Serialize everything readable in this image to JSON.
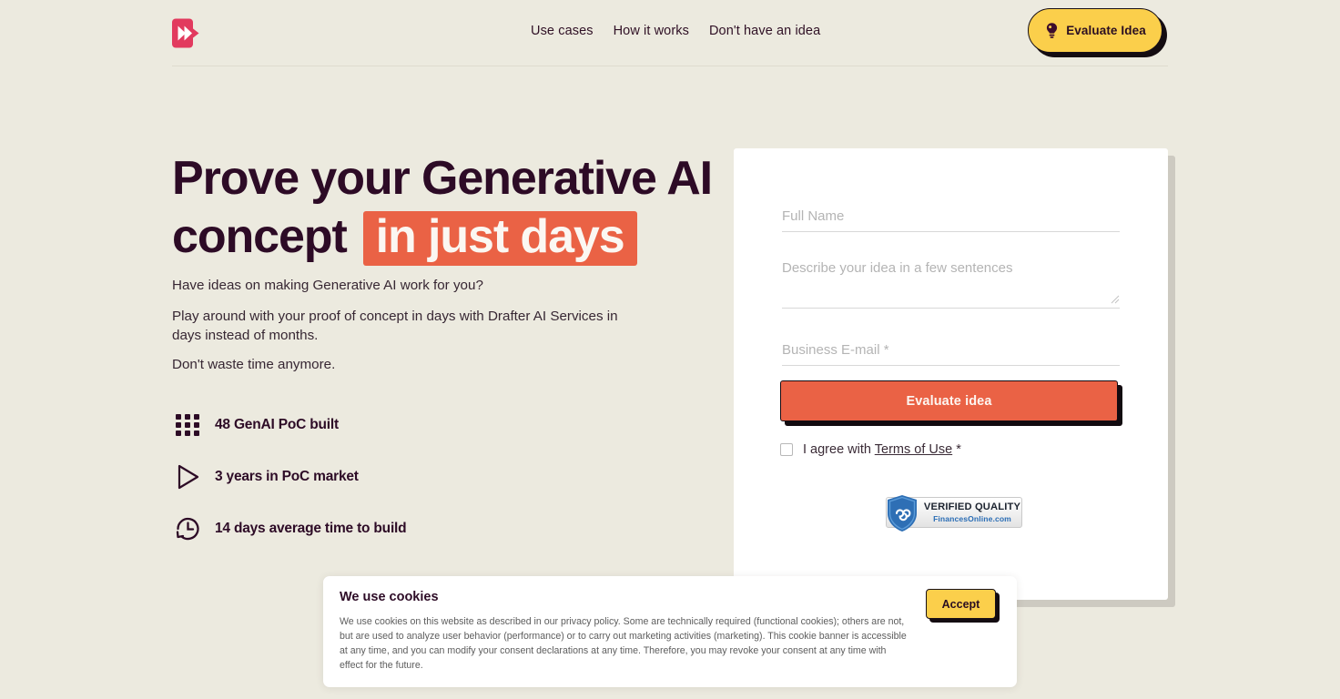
{
  "theme": {
    "page_bg": "#eceadf",
    "accent_orange": "#ea6245",
    "accent_yellow": "#fbcf4b",
    "ink": "#2d0b26"
  },
  "header": {
    "logo_name": "drafter-ai-logo",
    "nav": [
      {
        "label": "Use cases"
      },
      {
        "label": "How it works"
      },
      {
        "label": "Don't have an idea"
      }
    ],
    "cta": {
      "label": "Evaluate Idea",
      "icon": "lightbulb-icon"
    }
  },
  "hero": {
    "headline_line1": "Prove your Generative AI",
    "headline_line2_plain": "concept",
    "headline_line2_mark": "in just days",
    "paragraphs": [
      "Have ideas on making Generative AI work for you?",
      "Play around with your proof of concept in days with Drafter AI Services in days instead of months.",
      "Don't waste time anymore."
    ],
    "stats": [
      {
        "icon": "grid-icon",
        "label": "48 GenAI PoC built"
      },
      {
        "icon": "play-icon",
        "label": "3 years in PoC market"
      },
      {
        "icon": "clock-icon",
        "label": "14 days average time to build"
      }
    ]
  },
  "form": {
    "full_name": {
      "placeholder": "Full Name",
      "value": ""
    },
    "idea": {
      "placeholder": "Describe your idea in a few sentences",
      "value": ""
    },
    "email": {
      "placeholder": "Business E-mail *",
      "value": ""
    },
    "submit_label": "Evaluate idea",
    "agree": {
      "prefix": "I agree with",
      "link_label": "Terms of Use",
      "suffix": "*",
      "checked": false
    },
    "badge": {
      "line1": "VERIFIED QUALITY",
      "line2": "FinancesOnline.com",
      "icon": "shield-icon"
    }
  },
  "cookie_banner": {
    "title": "We use cookies",
    "body": "We use cookies on this website as described in our privacy policy. Some are technically required (functional cookies); others are not, but are used to analyze user behavior (performance) or to carry out marketing activities (marketing). This cookie banner is accessible at any time, and you can modify your consent declarations at any time. Therefore, you may revoke your consent at any time with effect for the future.",
    "accept_label": "Accept"
  }
}
